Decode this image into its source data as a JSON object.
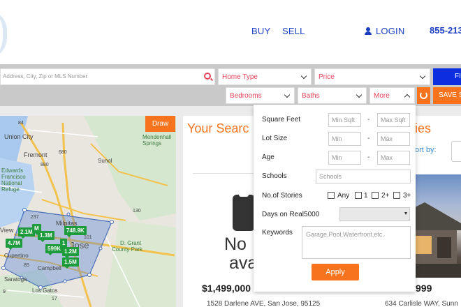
{
  "header": {
    "nav": {
      "buy": "BUY",
      "sell": "SELL",
      "login": "LOGIN"
    },
    "phone": "855-213",
    "accent_color": "#1a3fc1"
  },
  "search": {
    "placeholder": "Address, City, Zip or MLS Number",
    "home_type": "Home Type",
    "price": "Price",
    "find": "FI",
    "bedrooms": "Bedrooms",
    "baths": "Baths",
    "more": "More",
    "save": "SAVE S",
    "accent_color": "#f7731d"
  },
  "map": {
    "draw": "Draw",
    "labels": {
      "union_city": "Union City",
      "fremont": "Fremont",
      "edwards": "Edwards",
      "francisco": "Francisco",
      "national": "National",
      "refuge": "Refuge",
      "milpitas": "Milpitas",
      "sunol": "Sunol",
      "mendenhall": "Mendenhall",
      "springs": "Springs",
      "grant": "D. Grant",
      "county_park": "County Park",
      "cupertino": "Cupertino",
      "campbell": "Campbell",
      "saratoga": "Saratoga",
      "los_gatos": "Los Gatos",
      "jose": "Jose",
      "view": "View",
      "road_680": "680",
      "road_880": "880",
      "road_237": "237",
      "road_101": "101",
      "road_130": "130",
      "road_85": "85",
      "road_84": "84",
      "road_17": "17",
      "road_9": "9"
    },
    "pins": [
      "2.1M",
      "1.3M",
      "748.9K",
      "4.7M",
      "599K",
      "1.2M",
      "1.5M",
      "M",
      "1"
    ]
  },
  "results": {
    "heading": "Your Searc",
    "heading_right": "ies",
    "sort_label": "ort by:",
    "cards": [
      {
        "no_image_line1": "No",
        "no_image_line2": "ava",
        "price": "$1,499,000",
        "address": "1528 Darlene AVE, San Jose, 95125"
      },
      {
        "price": "999",
        "address": "634 Carlisle WAY, Sunn"
      }
    ]
  },
  "more_panel": {
    "square_feet": {
      "label": "Square Feet",
      "min": "Min Sqft",
      "max": "Max Sqft"
    },
    "lot_size": {
      "label": "Lot Size",
      "min": "Min",
      "max": "Max"
    },
    "age": {
      "label": "Age",
      "min": "Min",
      "max": "Max"
    },
    "dash": "-",
    "schools": {
      "label": "Schools",
      "placeholder": "Schools"
    },
    "stories": {
      "label": "No.of Stories",
      "options": [
        "Any",
        "1",
        "2+",
        "3+"
      ]
    },
    "days_on": {
      "label": "Days on Real5000",
      "value": ""
    },
    "keywords": {
      "label": "Keywords",
      "placeholder": "Garage,Pool,Waterfront,etc."
    },
    "apply": "Apply"
  }
}
